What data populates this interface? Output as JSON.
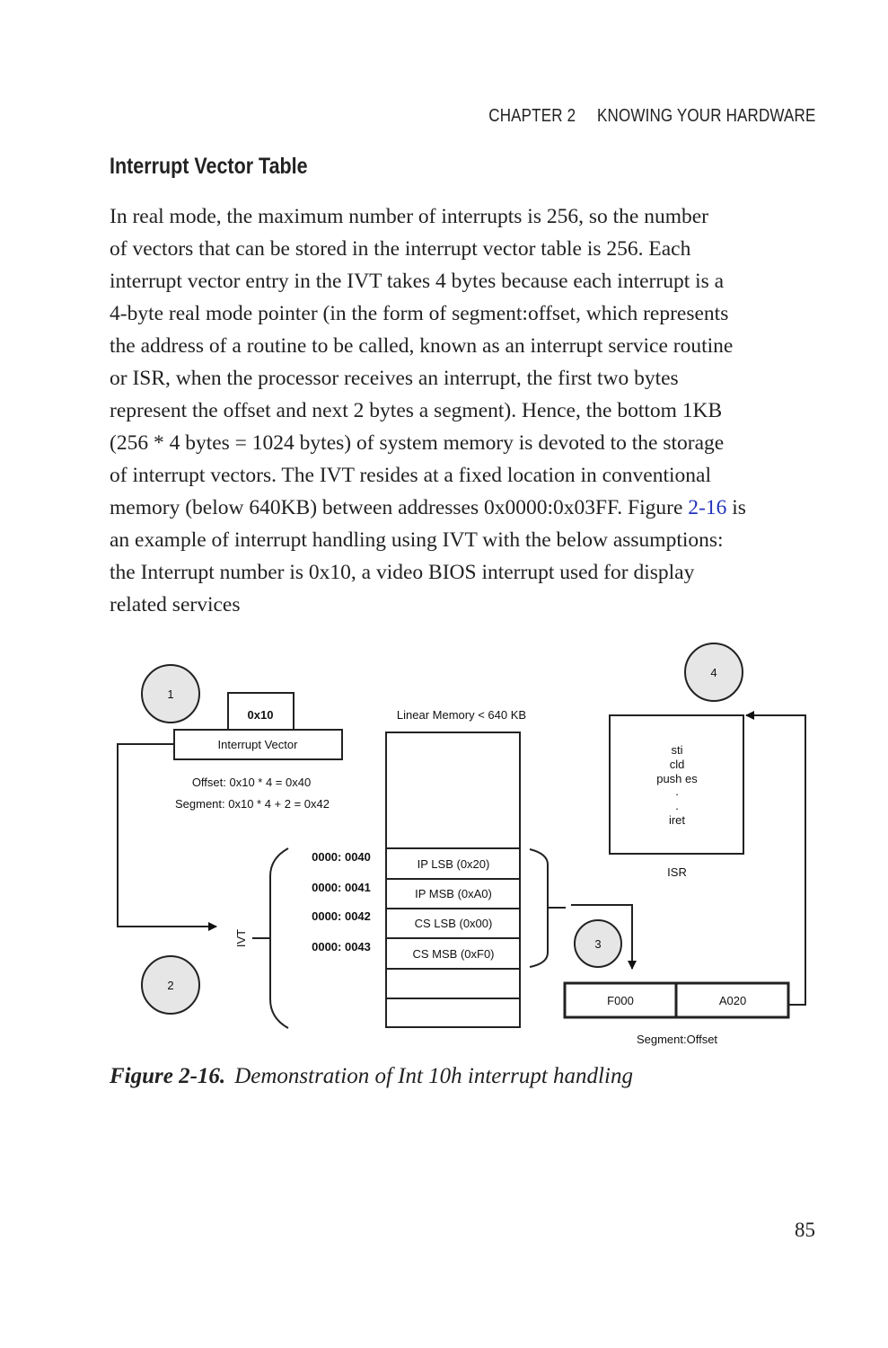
{
  "header": {
    "chapter": "CHAPTER 2",
    "title": "KNOWING YOUR HARDWARE"
  },
  "section_title": "Interrupt Vector Table",
  "body_lines": [
    "In real mode, the maximum number of interrupts is 256, so the number",
    "of vectors that can be stored in the interrupt vector table is 256. Each",
    "interrupt vector entry in the IVT takes 4 bytes because each interrupt is a",
    "4-byte real mode pointer (in the form of segment:offset, which represents",
    "the address of a routine to be called, known as an interrupt service routine",
    "or ISR, when the processor receives an interrupt, the first two bytes",
    "represent the offset and next 2 bytes a segment). Hence, the bottom 1KB",
    "(256 * 4 bytes = 1024 bytes) of system memory is devoted to the storage",
    "of interrupt vectors. The IVT resides at a fixed location in conventional"
  ],
  "body_line_link": {
    "before": "memory (below 640KB) between addresses 0x0000:0x03FF. Figure ",
    "link": "2-16",
    "after": " is"
  },
  "body_tail": [
    "an example of interrupt handling using IVT with the below assumptions:",
    "the Interrupt number is 0x10, a video BIOS interrupt used for display",
    "related services"
  ],
  "link_color": "#2233bb",
  "diagram": {
    "steps": [
      "1",
      "2",
      "3",
      "4"
    ],
    "vector_value": "0x10",
    "vector_label": "Interrupt Vector",
    "offset_calc": "Offset: 0x10 * 4 = 0x40",
    "segment_calc": "Segment: 0x10 * 4 + 2 = 0x42",
    "memory_label": "Linear Memory < 640 KB",
    "ivt_label": "IVT",
    "addresses": [
      "0000: 0040",
      "0000: 0041",
      "0000: 0042",
      "0000: 0043"
    ],
    "memory_cells": [
      "IP LSB (0x20)",
      "IP MSB (0xA0)",
      "CS LSB (0x00)",
      "CS MSB (0xF0)"
    ],
    "isr_code": [
      "sti",
      "cld",
      "push es",
      ".",
      ".",
      "iret"
    ],
    "isr_label": "ISR",
    "segment_value": "F000",
    "offset_value": "A020",
    "segoff_label": "Segment:Offset",
    "circle_fill": "#e6e6e6"
  },
  "caption": {
    "label": "Figure 2-16.",
    "text": "Demonstration of Int 10h interrupt handling"
  },
  "page_number": "85"
}
